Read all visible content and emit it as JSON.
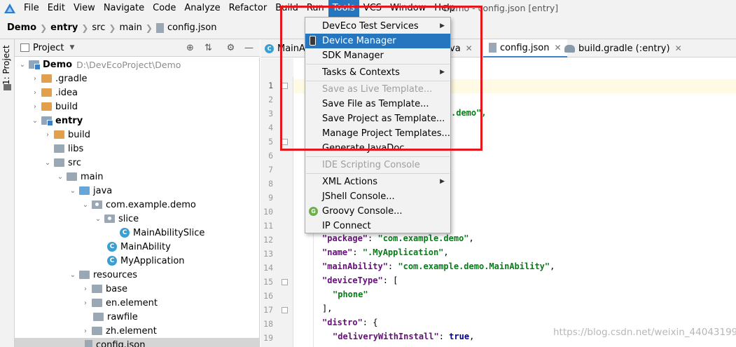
{
  "menubar": {
    "items": [
      "File",
      "Edit",
      "View",
      "Navigate",
      "Code",
      "Analyze",
      "Refactor",
      "Build",
      "Run",
      "Tools",
      "VCS",
      "Window",
      "Help"
    ],
    "window_title": "Demo - config.json [entry]"
  },
  "breadcrumb": [
    "Demo",
    "entry",
    "src",
    "main",
    "config.json"
  ],
  "stripe": {
    "label": "1: Project"
  },
  "project_panel": {
    "title": "Project"
  },
  "tree": [
    {
      "label": "Demo",
      "path": "D:\\DevEcoProject\\Demo"
    },
    {
      "label": ".gradle"
    },
    {
      "label": ".idea"
    },
    {
      "label": "build"
    },
    {
      "label": "entry"
    },
    {
      "label": "build"
    },
    {
      "label": "libs"
    },
    {
      "label": "src"
    },
    {
      "label": "main"
    },
    {
      "label": "java"
    },
    {
      "label": "com.example.demo"
    },
    {
      "label": "slice"
    },
    {
      "label": "MainAbilitySlice"
    },
    {
      "label": "MainAbility"
    },
    {
      "label": "MyApplication"
    },
    {
      "label": "resources"
    },
    {
      "label": "base"
    },
    {
      "label": "en.element"
    },
    {
      "label": "rawfile"
    },
    {
      "label": "zh.element"
    },
    {
      "label": "config.json"
    }
  ],
  "tabs": [
    {
      "label": "MainA",
      "icon": "class-icon"
    },
    {
      "label": "va",
      "icon": ""
    },
    {
      "label": "config.json",
      "icon": "json-file-icon"
    },
    {
      "label": "build.gradle (:entry)",
      "icon": "gradle-icon"
    }
  ],
  "tools_menu": {
    "items": [
      {
        "label": "DevEco Test Services",
        "submenu": true
      },
      {
        "label": "Device Manager",
        "highlighted": true,
        "icon": "phone-icon"
      },
      {
        "label": "SDK Manager"
      },
      {
        "label": "Tasks & Contexts",
        "submenu": true
      },
      {
        "label": "Save as Live Template...",
        "disabled": true
      },
      {
        "label": "Save File as Template..."
      },
      {
        "label": "Save Project as Template..."
      },
      {
        "label": "Manage Project Templates..."
      },
      {
        "label": "Generate JavaDoc..."
      },
      {
        "label": "IDE Scripting Console",
        "disabled": true
      },
      {
        "label": "XML Actions",
        "submenu": true
      },
      {
        "label": "JShell Console..."
      },
      {
        "label": "Groovy Console...",
        "icon": "groovy-icon"
      },
      {
        "label": "IP Connect"
      }
    ]
  },
  "editor": {
    "line_numbers": [
      "1",
      "2",
      "3",
      "4",
      "5",
      "6",
      "7",
      "8",
      "9",
      "10",
      "11",
      "12",
      "13",
      "14",
      "15",
      "16",
      "17",
      "18",
      "19"
    ],
    "visible_fragments": {
      "line3_tail": ".demo\","
    },
    "lines": {
      "l12": {
        "key": "\"package\"",
        "value": "\"com.example.demo\""
      },
      "l13": {
        "key": "\"name\"",
        "value": "\".MyApplication\""
      },
      "l14": {
        "key": "\"mainAbility\"",
        "value": "\"com.example.demo.MainAbility\""
      },
      "l15": {
        "key": "\"deviceType\"",
        "value": "["
      },
      "l16": {
        "value": "\"phone\""
      },
      "l17": {
        "value": "],"
      },
      "l18": {
        "key": "\"distro\"",
        "value": "{"
      },
      "l19": {
        "key": "\"deliveryWithInstall\"",
        "value": "true"
      }
    }
  },
  "watermark": "https://blog.csdn.net/weixin_44043199",
  "colors": {
    "accent": "#2675bf",
    "annotation_box": "#e5171d",
    "json_key": "#660e7a",
    "json_string": "#067d17",
    "json_literal": "#000080"
  }
}
